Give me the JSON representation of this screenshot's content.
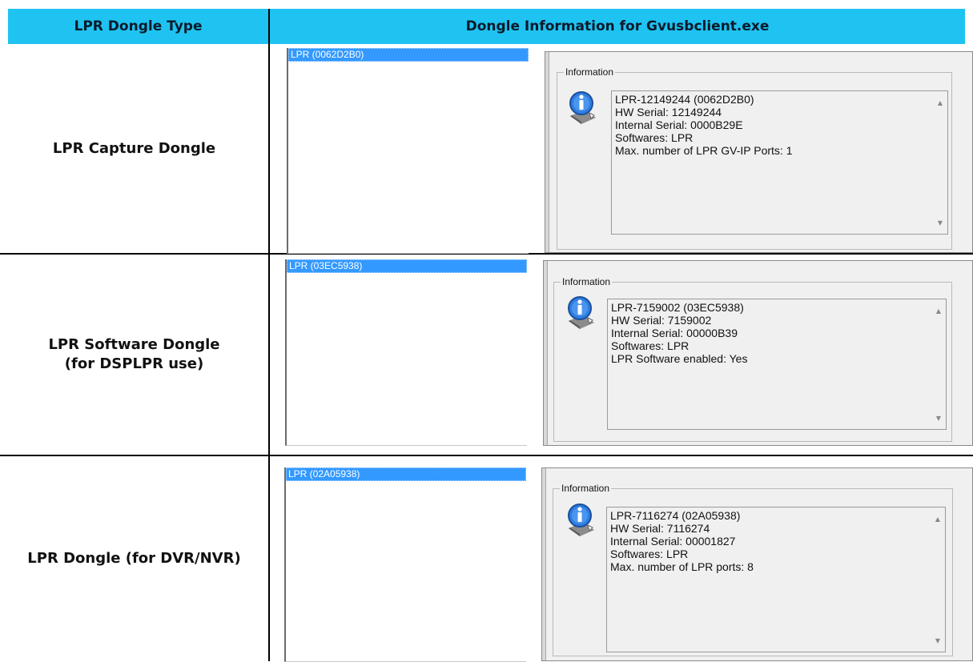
{
  "header": {
    "col1": "LPR Dongle Type",
    "col2": "Dongle Information for Gvusbclient.exe"
  },
  "group_title": "Information",
  "rows": [
    {
      "type_label": "LPR Capture Dongle",
      "list_item": "LPR (0062D2B0)",
      "info_lines": [
        "LPR-12149244 (0062D2B0)",
        "HW Serial: 12149244",
        "Internal Serial: 0000B29E",
        "Softwares: LPR",
        "Max. number of LPR GV-IP Ports: 1"
      ]
    },
    {
      "type_label": "LPR Software Dongle\n(for DSPLPR use)",
      "list_item": "LPR (03EC5938)",
      "info_lines": [
        "LPR-7159002 (03EC5938)",
        "HW Serial: 7159002",
        "Internal Serial: 00000B39",
        "Softwares: LPR",
        "LPR Software enabled: Yes"
      ]
    },
    {
      "type_label": "LPR Dongle (for DVR/NVR)",
      "list_item": "LPR (02A05938)",
      "info_lines": [
        "LPR-7116274 (02A05938)",
        "HW Serial: 7116274",
        "Internal Serial: 00001827",
        "Softwares: LPR",
        "Max. number of LPR ports: 8"
      ]
    }
  ],
  "icons": {
    "info": "info-icon",
    "scroll_up": "scroll-up-arrow-icon",
    "scroll_down": "scroll-down-arrow-icon"
  },
  "colors": {
    "header_bg": "#1ec3f2",
    "selection_bg": "#3399ff"
  }
}
